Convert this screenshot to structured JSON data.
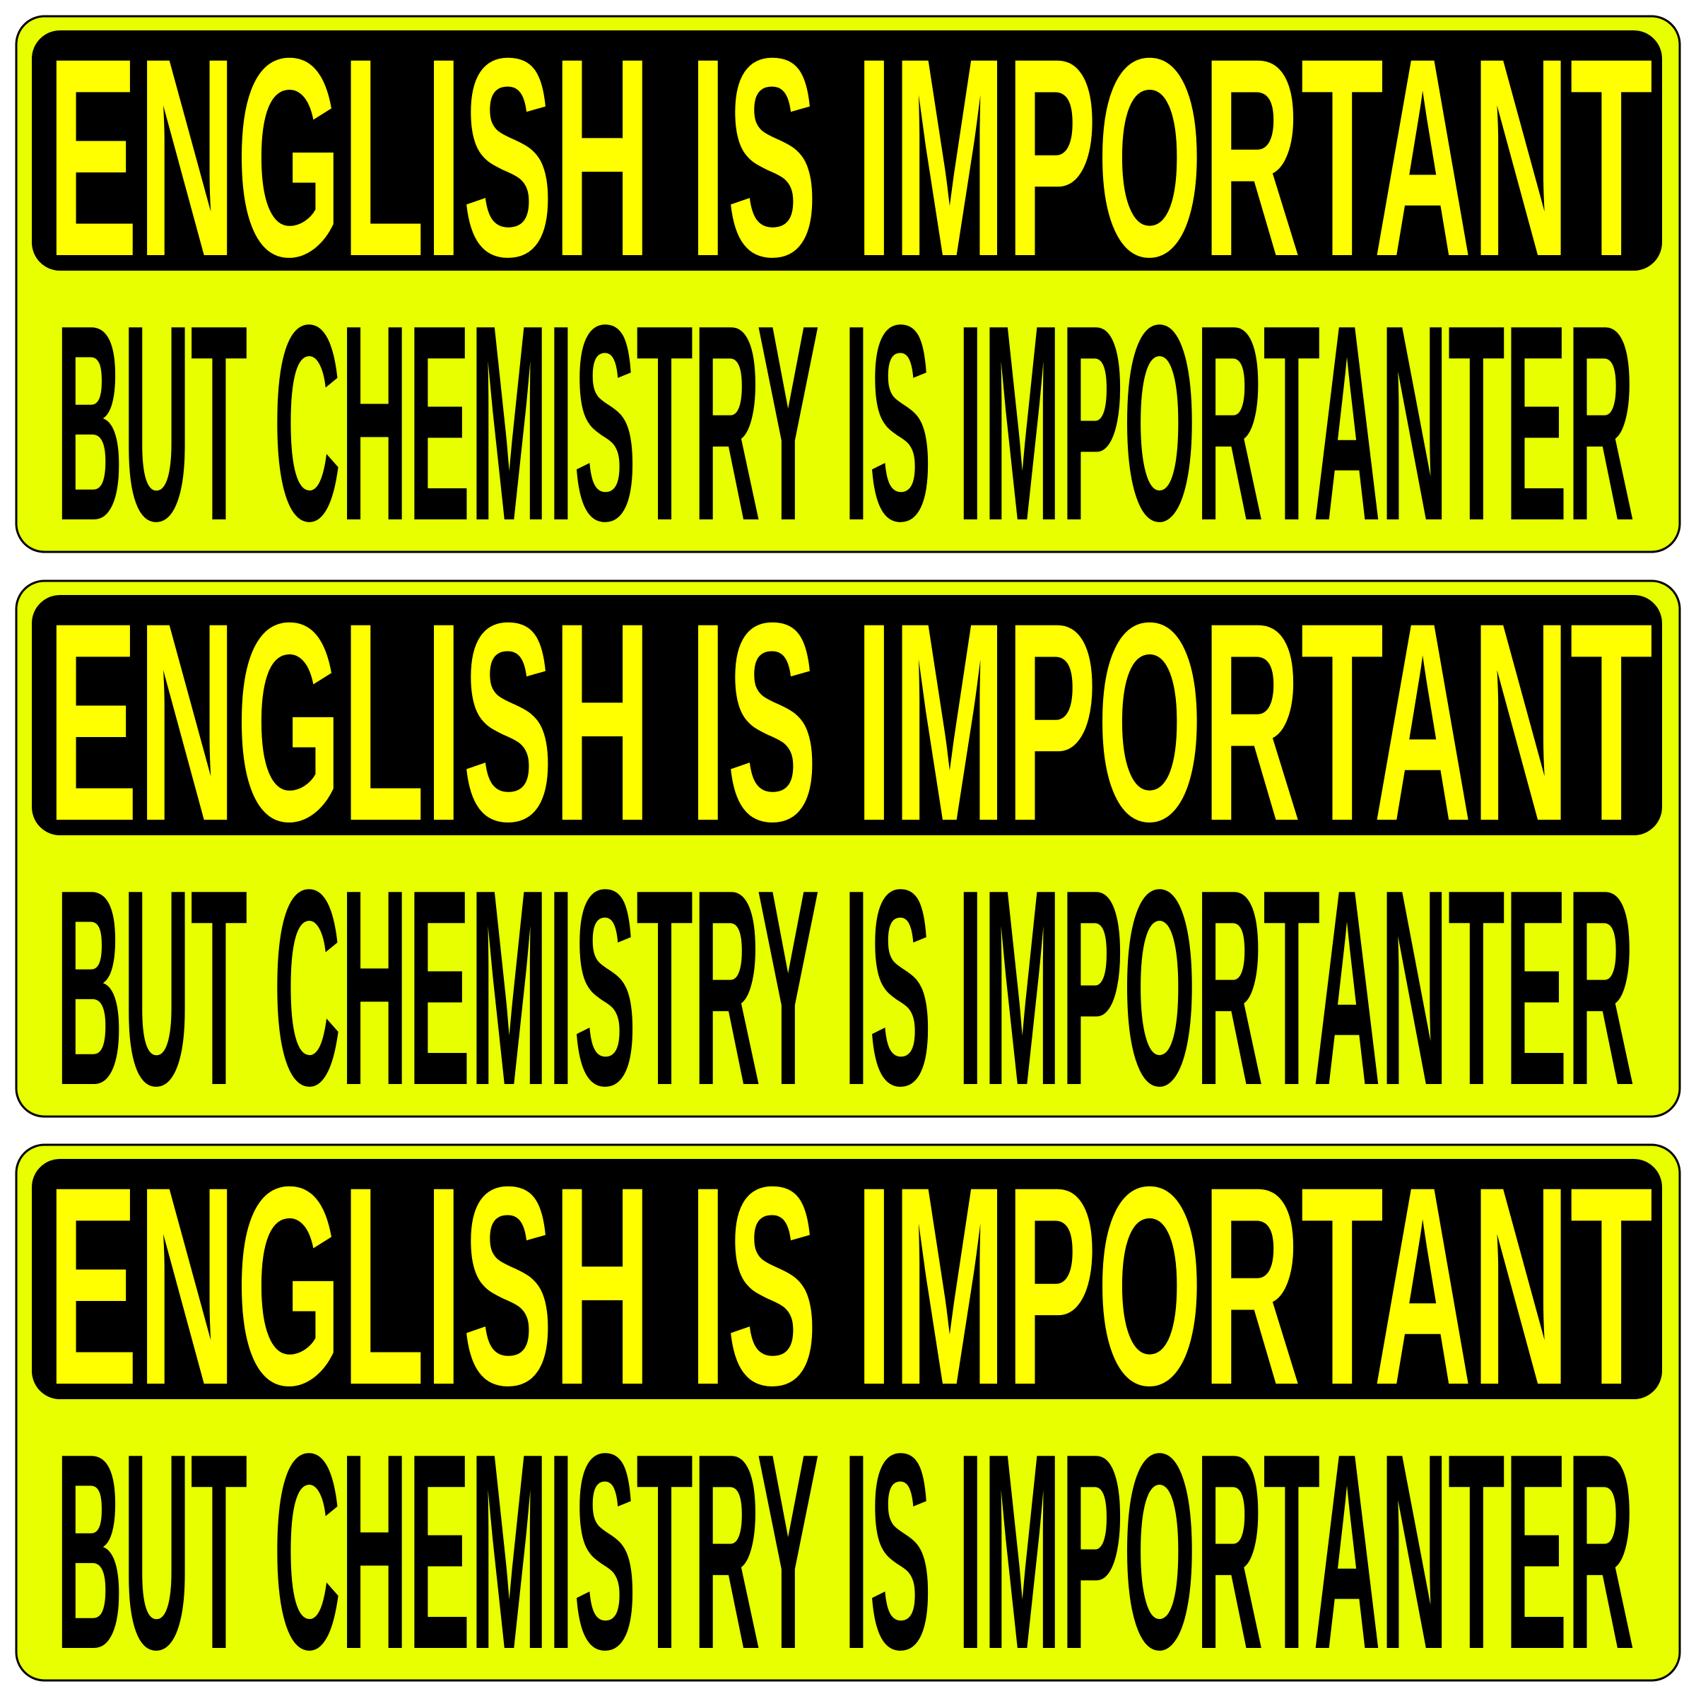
{
  "colors": {
    "sticker_bg": "#E8FF00",
    "banner": "#000000",
    "banner_text": "#FFFF00",
    "body_text": "#000000"
  },
  "stickers": [
    {
      "line1": "ENGLISH IS IMPORTANT",
      "line2": "BUT CHEMISTRY IS IMPORTANTER"
    },
    {
      "line1": "ENGLISH IS IMPORTANT",
      "line2": "BUT CHEMISTRY IS IMPORTANTER"
    },
    {
      "line1": "ENGLISH IS IMPORTANT",
      "line2": "BUT CHEMISTRY IS IMPORTANTER"
    }
  ]
}
